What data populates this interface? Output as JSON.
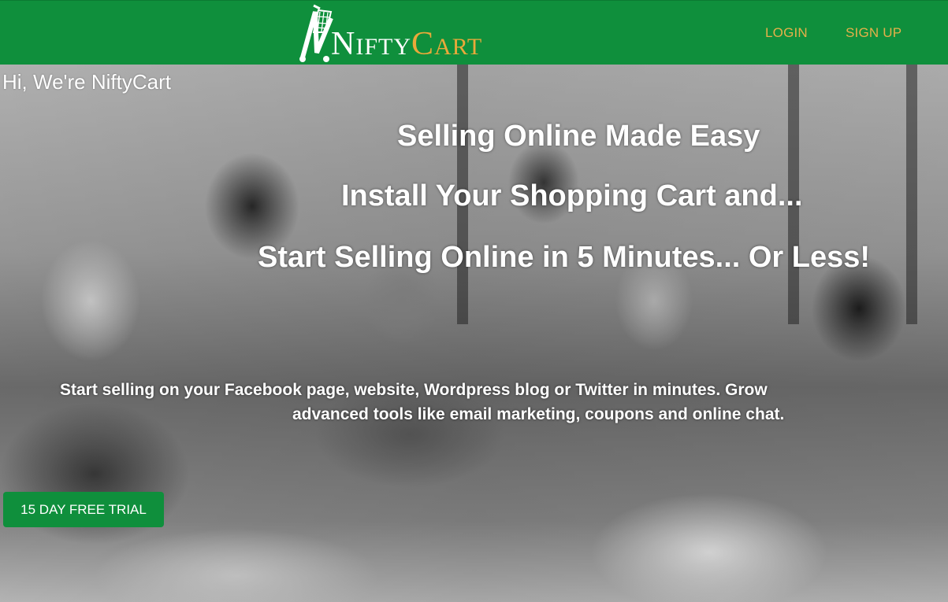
{
  "brand": {
    "logo_letters": [
      "N",
      "IFTY",
      "C",
      "ART"
    ],
    "accent_color": "#e9a93a",
    "primary_color": "#0f8f3c"
  },
  "nav": {
    "login_label": "LOGIN",
    "signup_label": "SIGN UP"
  },
  "hero": {
    "greeting": "Hi, We're NiftyCart",
    "headline_1": "Selling Online Made Easy",
    "headline_2": "Install Your Shopping Cart and...",
    "headline_3": "Start Selling Online in 5 Minutes... Or Less!",
    "description_line_1": "Start selling on your Facebook page, website, Wordpress blog or Twitter in minutes. Grow",
    "description_line_2": "advanced tools like email marketing, coupons and online chat.",
    "cta_label": "15 DAY FREE TRIAL"
  }
}
